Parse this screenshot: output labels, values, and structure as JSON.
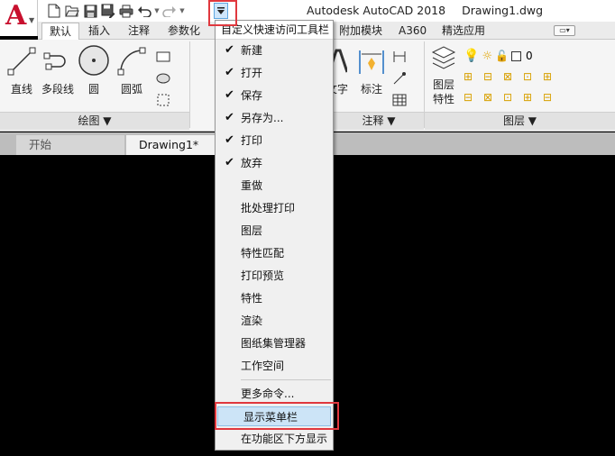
{
  "app_title": {
    "product": "Autodesk AutoCAD 2018",
    "document": "Drawing1.dwg"
  },
  "ribbon_tabs": [
    "默认",
    "插入",
    "注释",
    "参数化",
    "附加模块",
    "A360",
    "精选应用"
  ],
  "ribbon": {
    "draw_tools": [
      "直线",
      "多段线",
      "圆",
      "圆弧"
    ],
    "draw_panel_title": "绘图 ▼",
    "annotation_tools": [
      "文字",
      "标注"
    ],
    "annotation_panel_title": "注释 ▼",
    "layer_tool": "图层\n特性",
    "layer_current": "0",
    "layer_panel_title": "图层 ▼"
  },
  "doc_tabs": [
    "开始",
    "Drawing1*"
  ],
  "qat_menu": {
    "header": "自定义快速访问工具栏",
    "items": [
      {
        "label": "新建",
        "checked": true
      },
      {
        "label": "打开",
        "checked": true
      },
      {
        "label": "保存",
        "checked": true
      },
      {
        "label": "另存为...",
        "checked": true
      },
      {
        "label": "打印",
        "checked": true
      },
      {
        "label": "放弃",
        "checked": true
      },
      {
        "label": "重做",
        "checked": false
      },
      {
        "label": "批处理打印",
        "checked": false
      },
      {
        "label": "图层",
        "checked": false
      },
      {
        "label": "特性匹配",
        "checked": false
      },
      {
        "label": "打印预览",
        "checked": false
      },
      {
        "label": "特性",
        "checked": false
      },
      {
        "label": "渲染",
        "checked": false
      },
      {
        "label": "图纸集管理器",
        "checked": false
      },
      {
        "label": "工作空间",
        "checked": false
      }
    ],
    "more_commands": "更多命令...",
    "show_menubar": "显示菜单栏",
    "show_below_ribbon": "在功能区下方显示"
  },
  "colors": {
    "highlight_border": "#e0383e",
    "autocad_red": "#c8102e",
    "selection_blue": "#cce4f7"
  },
  "icons": {
    "app_logo": "autocad-a-icon",
    "checkmark": "✔"
  }
}
